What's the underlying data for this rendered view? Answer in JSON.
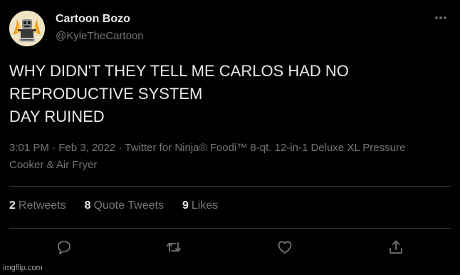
{
  "author": {
    "display_name": "Cartoon Bozo",
    "handle": "@KyleTheCartoon",
    "avatar_icon": "avatar-image"
  },
  "tweet": {
    "text_lines": [
      "WHY DIDN'T THEY TELL ME CARLOS HAD NO",
      "REPRODUCTIVE SYSTEM",
      "DAY RUINED"
    ],
    "meta_lines": [
      "3:01 PM · Feb 3, 2022 · Twitter for Ninja® Foodi™ 8-qt. 12-in-1 Deluxe XL Pressure",
      "Cooker & Air Fryer"
    ]
  },
  "stats": {
    "retweets_count": "2",
    "retweets_label": "Retweets",
    "quote_count": "8",
    "quote_label": "Quote Tweets",
    "likes_count": "9",
    "likes_label": "Likes"
  },
  "actions": {
    "reply_icon": "reply-icon",
    "retweet_icon": "retweet-icon",
    "like_icon": "heart-icon",
    "share_icon": "share-icon"
  },
  "more_icon": "more-icon",
  "watermark": "imgflip.com",
  "colors": {
    "background": "#000000",
    "primary_text": "#e7e9ea",
    "secondary_text": "#71767b",
    "divider": "#2f3336"
  }
}
